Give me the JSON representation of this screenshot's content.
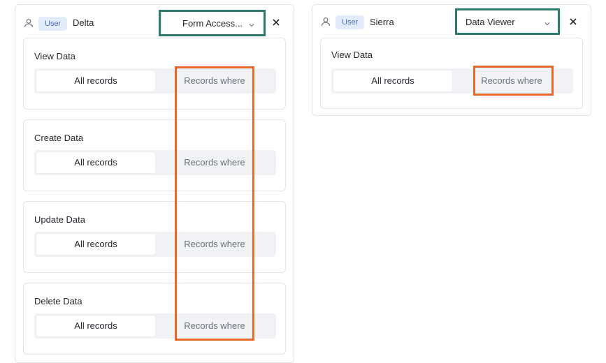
{
  "panels": [
    {
      "user": {
        "badge": "User",
        "name": "Delta"
      },
      "role_select": {
        "value": "Form Access..."
      },
      "sections": [
        {
          "title": "View Data",
          "options": [
            "All records",
            "Records where"
          ],
          "selected": "All records"
        },
        {
          "title": "Create Data",
          "options": [
            "All records",
            "Records where"
          ],
          "selected": "All records"
        },
        {
          "title": "Update Data",
          "options": [
            "All records",
            "Records where"
          ],
          "selected": "All records"
        },
        {
          "title": "Delete Data",
          "options": [
            "All records",
            "Records where"
          ],
          "selected": "All records"
        }
      ]
    },
    {
      "user": {
        "badge": "User",
        "name": "Sierra"
      },
      "role_select": {
        "value": "Data Viewer"
      },
      "sections": [
        {
          "title": "View Data",
          "options": [
            "All records",
            "Records where"
          ],
          "selected": "All records"
        }
      ]
    }
  ],
  "colors": {
    "highlight_select": "#2d7a70",
    "highlight_option": "#e8672b",
    "badge_bg": "#e3ecfb",
    "badge_text": "#4a6fb5",
    "segment_bg": "#f0f2f5"
  },
  "icons": {
    "user": "user-icon",
    "chevron": "chevron-down-icon",
    "close": "close-icon"
  }
}
